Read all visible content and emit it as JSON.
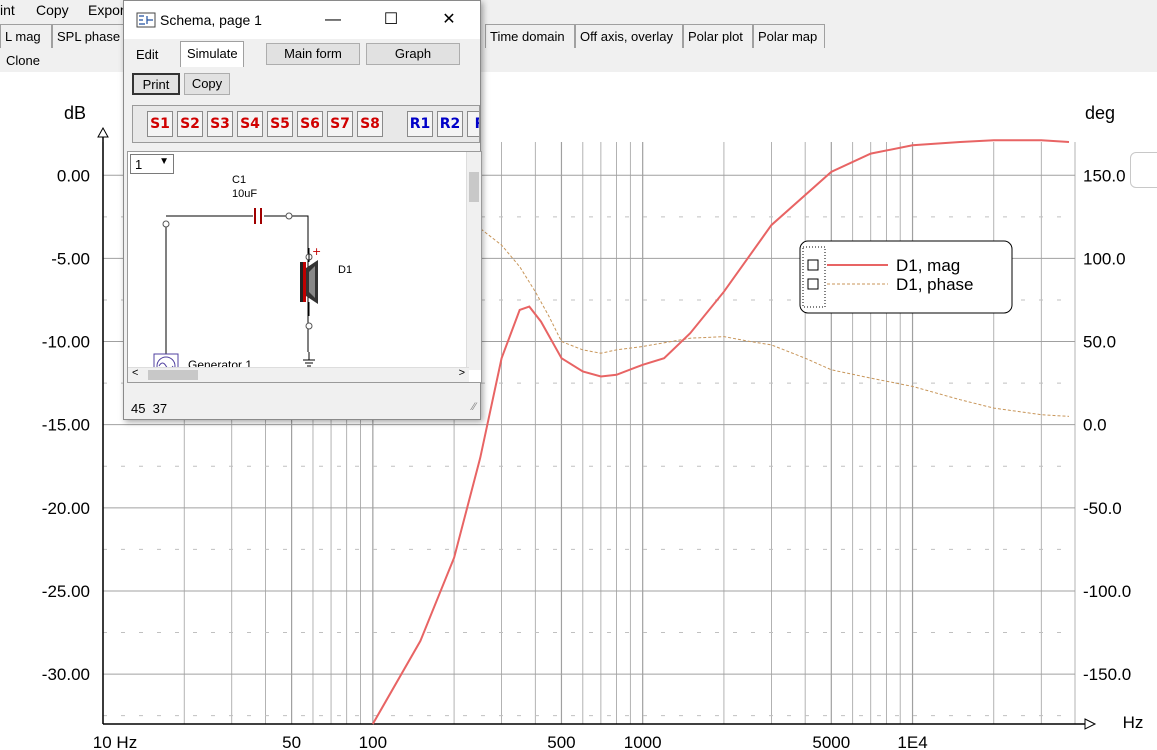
{
  "menu": {
    "items": [
      "int",
      "Copy",
      "Expor"
    ]
  },
  "tabs": [
    "L mag",
    "SPL phase",
    "Time domain",
    "Off axis, overlay",
    "Polar plot",
    "Polar map"
  ],
  "clone_label": "Clone",
  "dialog": {
    "title": "Schema, page 1",
    "tabs": {
      "edit": "Edit",
      "simulate": "Simulate"
    },
    "buttons": {
      "main_form": "Main form",
      "graph": "Graph",
      "print": "Print",
      "copy": "Copy"
    },
    "source_buttons": [
      "S1",
      "S2",
      "S3",
      "S4",
      "S5",
      "S6",
      "S7",
      "S8"
    ],
    "receiver_buttons": [
      "R1",
      "R2",
      "R"
    ],
    "page_select": "1",
    "schematic": {
      "cap_name": "C1",
      "cap_value": "10uF",
      "driver_name": "D1",
      "generator_name": "Generator 1"
    },
    "status": "45  37",
    "colors": {
      "source_red": "#d00000",
      "receiver_blue": "#0000c8"
    }
  },
  "chart_data": {
    "type": "line",
    "x_scale": "log",
    "xlim": [
      10,
      40000
    ],
    "ylim_left": [
      -33,
      2
    ],
    "ylim_right": [
      -180,
      170
    ],
    "left_unit": "dB",
    "right_unit": "deg",
    "x_unit": "Hz",
    "left_ticks": [
      "0.00",
      "-5.00",
      "-10.00",
      "-15.00",
      "-20.00",
      "-25.00",
      "-30.00"
    ],
    "right_ticks": [
      "150.0",
      "100.0",
      "50.0",
      "0.0",
      "-50.0",
      "-100.0",
      "-150.0"
    ],
    "x_ticks": [
      "10 Hz",
      "50",
      "100",
      "500",
      "1000",
      "5000",
      "1E4"
    ],
    "legend": {
      "mag": "D1, mag",
      "phase": "D1, phase"
    },
    "colors": {
      "mag": "#e86464",
      "phase": "#c8965a",
      "grid": "#a0a0a0"
    },
    "series": [
      {
        "name": "D1, mag",
        "x": [
          100,
          150,
          200,
          250,
          300,
          350,
          380,
          420,
          500,
          600,
          700,
          800,
          1000,
          1200,
          1500,
          2000,
          3000,
          5000,
          7000,
          10000,
          15000,
          20000,
          30000,
          38000
        ],
        "y": [
          -33,
          -28,
          -23,
          -17,
          -11,
          -8.1,
          -7.9,
          -8.8,
          -11.0,
          -11.8,
          -12.1,
          -12.0,
          -11.4,
          -11.0,
          -9.5,
          -7.0,
          -3.0,
          0.2,
          1.3,
          1.8,
          2.0,
          2.1,
          2.1,
          2.0
        ]
      },
      {
        "name": "D1, phase",
        "x": [
          130,
          200,
          250,
          300,
          350,
          400,
          450,
          500,
          600,
          700,
          800,
          1000,
          1500,
          2000,
          2500,
          3000,
          4000,
          5000,
          7000,
          10000,
          15000,
          20000,
          30000,
          38000
        ],
        "y": [
          135,
          130,
          118,
          108,
          95,
          80,
          65,
          50,
          45,
          43,
          45,
          47,
          52,
          53,
          50,
          48,
          40,
          33,
          28,
          23,
          15,
          10,
          6,
          5
        ]
      }
    ]
  }
}
